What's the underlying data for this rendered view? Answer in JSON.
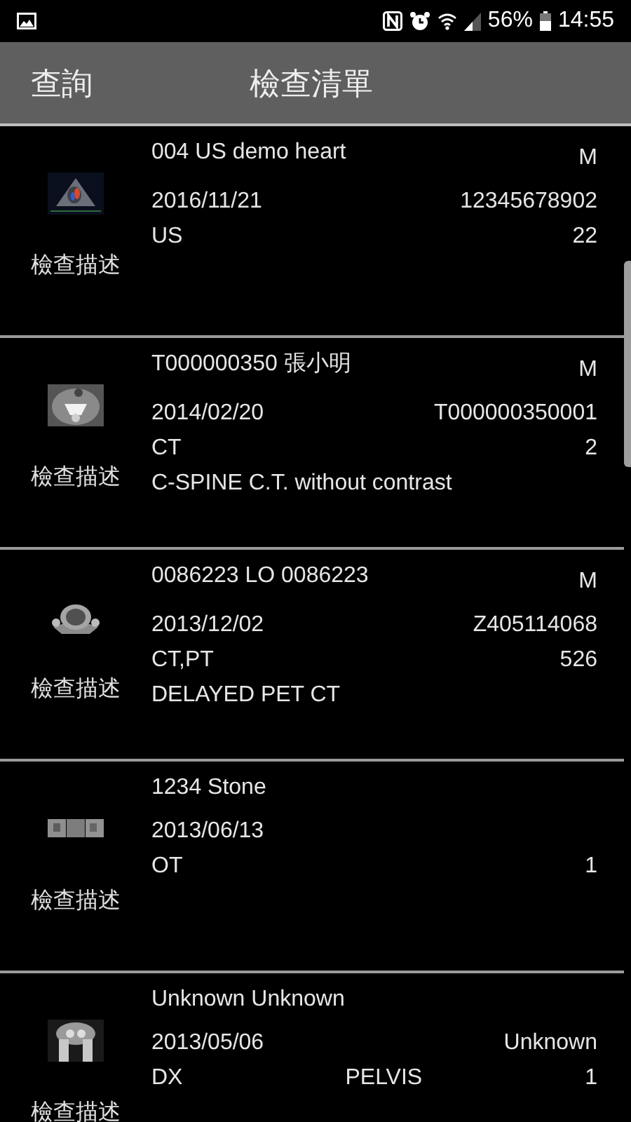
{
  "status_bar": {
    "battery": "56%",
    "time": "14:55"
  },
  "header": {
    "search": "查詢",
    "title": "檢查清單"
  },
  "studies": [
    {
      "name": "004 US demo heart",
      "sex": "M",
      "date": "2016/11/21",
      "id": "12345678902",
      "modality": "US",
      "count": "22",
      "label": "檢查描述"
    },
    {
      "name": "T000000350 張小明",
      "sex": "M",
      "date": "2014/02/20",
      "id": "T000000350001",
      "modality": "CT",
      "count": "2",
      "description": "C-SPINE C.T. without contrast",
      "label": "檢查描述"
    },
    {
      "name": "0086223 LO 0086223",
      "sex": "M",
      "date": "2013/12/02",
      "id": "Z405114068",
      "modality": "CT,PT",
      "count": "526",
      "description": "DELAYED PET CT",
      "label": "檢查描述"
    },
    {
      "name": "1234 Stone",
      "date": "2013/06/13",
      "modality": "OT",
      "count": "1",
      "label": "檢查描述"
    },
    {
      "name": "Unknown Unknown",
      "date": "2013/05/06",
      "id": "Unknown",
      "modality": "DX",
      "body_part": "PELVIS",
      "count": "1",
      "label": "檢查描述"
    }
  ]
}
